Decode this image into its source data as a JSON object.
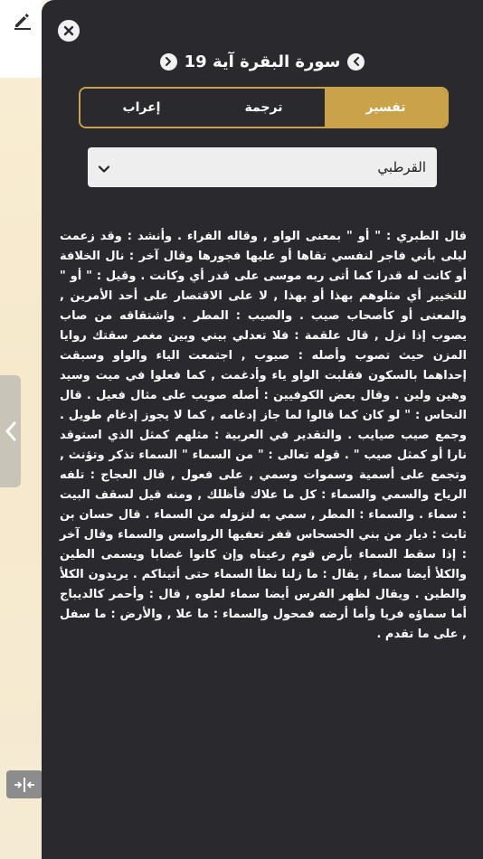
{
  "panel": {
    "title": "سورة البقرة آية 19",
    "tabs": [
      {
        "label": "تفسير",
        "active": true
      },
      {
        "label": "ترجمة",
        "active": false
      },
      {
        "label": "إعراب",
        "active": false
      }
    ],
    "tafsir_source": "القرطبي",
    "body_text": "قال الطبري : \" أو \" بمعنى الواو , وقاله الفراء . وأنشد : وقد زعمت ليلى بأني فاجر لنفسي تقاها أو عليها فجورها وقال آخر : نال الخلافة أو كانت له قدرا كما أتى ربه موسى على قدر أي وكانت . وقيل : \" أو \" للتخيير أي مثلوهم بهذا أو بهذا , لا على الاقتصار على أحد الأمرين , والمعنى أو كأصحاب صيب . والصيب : المطر . واشتقاقه من صاب يصوب إذا نزل , قال علقمة : فلا تعدلي بيني وبين مغمر سقتك روايا المزن حيث تصوب وأصله : صيوب , اجتمعت الياء والواو وسبقت إحداهما بالسكون فقلبت الواو ياء وأدغمت , كما فعلوا في ميت وسيد وهين ولين . وقال بعض الكوفيين : أصله صويب على مثال فعيل . قال النحاس : \" لو كان كما قالوا لما جاز إدغامه , كما لا يجوز إدغام طويل . وجمع صيب صيايب . والتقدير في العربية : مثلهم كمثل الذي استوقد نارا أو كمثل صيب \" . قوله تعالى : \" من السماء \" السماء تذكر وتؤنث , وتجمع على أسمية وسموات وسمي , على فعول , قال العجاج : تلفه الرياح والسمي والسماء : كل ما علاك فأظلك , ومنه قيل لسقف البيت : سماء . والسماء : المطر , سمي به لنزوله من السماء . قال حسان بن ثابت : ديار من بني الحسحاس قفر تعفيها الرواسس والسماء وقال آخر : إذا سقط السماء بأرض قوم رعيناه وإن كانوا غضابا ويسمى الطين والكلأ أيضا سماء , يقال : ما زلنا نطأ السماء حتى أتيناكم . يريدون الكلأ والطين . ويقال لظهر الفرس أيضا سماء لعلوه , قال : وأحمر كالديباج أما سماؤه فريا وأما أرضه فمحول والسماء : ما علا , والأرض : ما سفل , على ما تقدم ."
  },
  "icons": {
    "edit": "pencil-icon",
    "close": "close-icon",
    "prev": "chevron-left-icon",
    "next": "chevron-right-icon",
    "dropdown": "chevron-down-icon",
    "side_tab": "chevron-left-icon",
    "split": "split-view-icon"
  },
  "colors": {
    "panel_bg": "#2a2a2e",
    "accent": "#c9a24a",
    "text": "#ffffff",
    "select_bg": "#eeeeee"
  }
}
